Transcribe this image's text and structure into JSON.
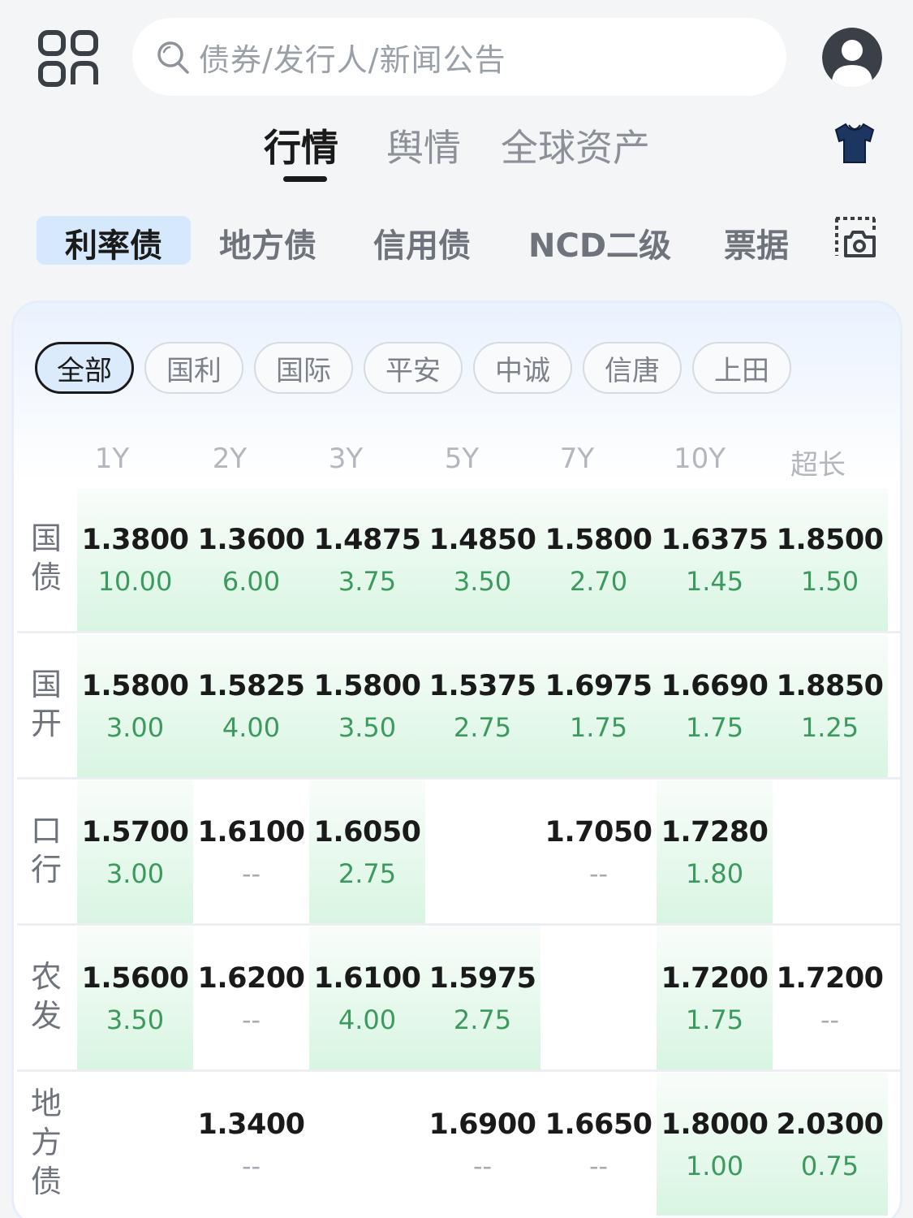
{
  "header": {
    "search_placeholder": "债券/发行人/新闻公告"
  },
  "top_tabs": [
    {
      "label": "行情",
      "active": true
    },
    {
      "label": "舆情",
      "active": false
    },
    {
      "label": "全球资产",
      "active": false
    }
  ],
  "categories": [
    {
      "label": "利率债",
      "active": true
    },
    {
      "label": "地方债",
      "active": false
    },
    {
      "label": "信用债",
      "active": false
    },
    {
      "label": "NCD二级",
      "active": false
    },
    {
      "label": "票据",
      "active": false
    }
  ],
  "brokers": [
    {
      "label": "全部",
      "active": true
    },
    {
      "label": "国利",
      "active": false
    },
    {
      "label": "国际",
      "active": false
    },
    {
      "label": "平安",
      "active": false
    },
    {
      "label": "中诚",
      "active": false
    },
    {
      "label": "信唐",
      "active": false
    },
    {
      "label": "上田",
      "active": false
    }
  ],
  "table": {
    "columns": [
      "1Y",
      "2Y",
      "3Y",
      "5Y",
      "7Y",
      "10Y",
      "超长"
    ],
    "rows": [
      {
        "label": "国债",
        "cells": [
          {
            "yield": "1.3800",
            "change": "10.00",
            "highlight": true
          },
          {
            "yield": "1.3600",
            "change": "6.00",
            "highlight": true
          },
          {
            "yield": "1.4875",
            "change": "3.75",
            "highlight": true
          },
          {
            "yield": "1.4850",
            "change": "3.50",
            "highlight": true
          },
          {
            "yield": "1.5800",
            "change": "2.70",
            "highlight": true
          },
          {
            "yield": "1.6375",
            "change": "1.45",
            "highlight": true
          },
          {
            "yield": "1.8500",
            "change": "1.50",
            "highlight": true
          }
        ]
      },
      {
        "label": "国开",
        "cells": [
          {
            "yield": "1.5800",
            "change": "3.00",
            "highlight": true
          },
          {
            "yield": "1.5825",
            "change": "4.00",
            "highlight": true
          },
          {
            "yield": "1.5800",
            "change": "3.50",
            "highlight": true
          },
          {
            "yield": "1.5375",
            "change": "2.75",
            "highlight": true
          },
          {
            "yield": "1.6975",
            "change": "1.75",
            "highlight": true
          },
          {
            "yield": "1.6690",
            "change": "1.75",
            "highlight": true
          },
          {
            "yield": "1.8850",
            "change": "1.25",
            "highlight": true
          }
        ]
      },
      {
        "label": "口行",
        "cells": [
          {
            "yield": "1.5700",
            "change": "3.00",
            "highlight": true
          },
          {
            "yield": "1.6100",
            "change": "--",
            "highlight": false
          },
          {
            "yield": "1.6050",
            "change": "2.75",
            "highlight": true
          },
          {
            "yield": "",
            "change": "",
            "highlight": false
          },
          {
            "yield": "1.7050",
            "change": "--",
            "highlight": false
          },
          {
            "yield": "1.7280",
            "change": "1.80",
            "highlight": true
          },
          {
            "yield": "",
            "change": "",
            "highlight": false
          }
        ]
      },
      {
        "label": "农发",
        "cells": [
          {
            "yield": "1.5600",
            "change": "3.50",
            "highlight": true
          },
          {
            "yield": "1.6200",
            "change": "--",
            "highlight": false
          },
          {
            "yield": "1.6100",
            "change": "4.00",
            "highlight": true
          },
          {
            "yield": "1.5975",
            "change": "2.75",
            "highlight": true
          },
          {
            "yield": "",
            "change": "",
            "highlight": false
          },
          {
            "yield": "1.7200",
            "change": "1.75",
            "highlight": true
          },
          {
            "yield": "1.7200",
            "change": "--",
            "highlight": false
          }
        ]
      },
      {
        "label": "地方债",
        "cells": [
          {
            "yield": "",
            "change": "",
            "highlight": false
          },
          {
            "yield": "1.3400",
            "change": "--",
            "highlight": false
          },
          {
            "yield": "",
            "change": "",
            "highlight": false
          },
          {
            "yield": "1.6900",
            "change": "--",
            "highlight": false
          },
          {
            "yield": "1.6650",
            "change": "--",
            "highlight": false
          },
          {
            "yield": "1.8000",
            "change": "1.00",
            "highlight": true
          },
          {
            "yield": "2.0300",
            "change": "0.75",
            "highlight": true
          }
        ]
      }
    ]
  },
  "colors": {
    "accent_active_bg": "#d6e8fb",
    "highlight_green": "#d8f5e2",
    "change_text": "#3c9a5f"
  },
  "icons": [
    "apps-grid-icon",
    "search-icon",
    "avatar-icon",
    "shirt-icon",
    "scan-camera-icon"
  ]
}
